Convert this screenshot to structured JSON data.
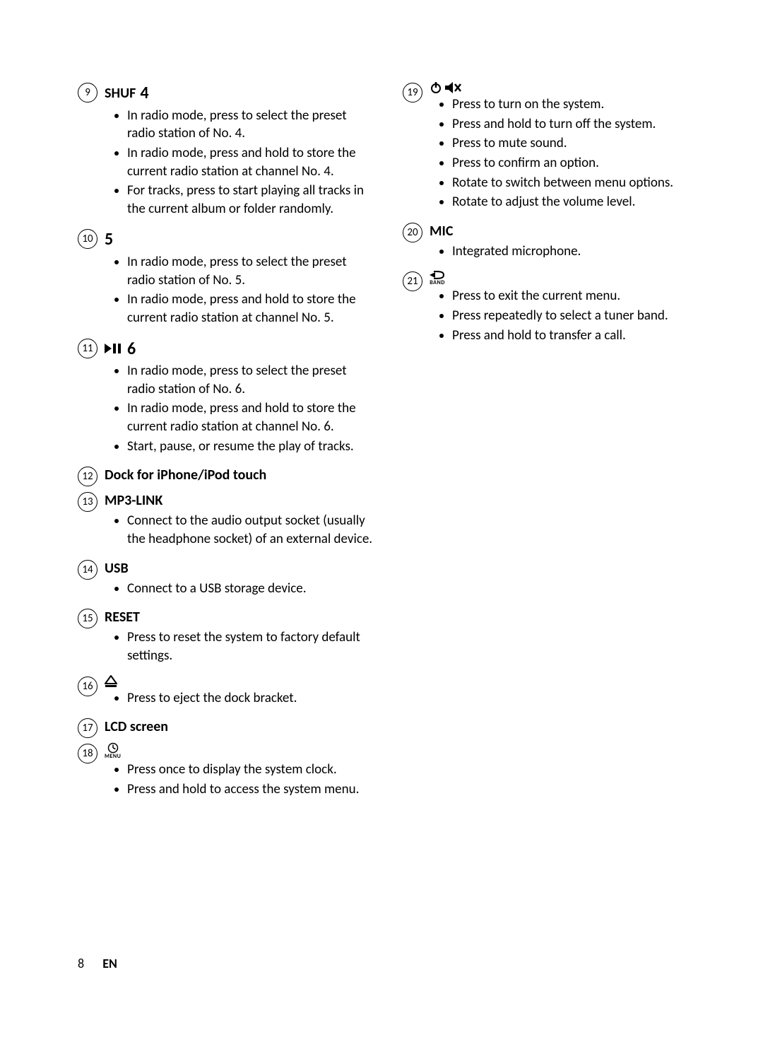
{
  "footer": {
    "page": "8",
    "lang": "EN"
  },
  "left": [
    {
      "num": "9",
      "title_parts": [
        {
          "t": "SHUF "
        },
        {
          "t": "4",
          "cls": "big-num"
        }
      ],
      "bullets": [
        "In radio mode, press to select the preset radio station of No. 4.",
        "In radio mode, press and hold to store the current radio station at channel No. 4.",
        "For tracks, press to start playing all tracks in the current album or folder randomly."
      ]
    },
    {
      "num": "10",
      "title_parts": [
        {
          "t": "5",
          "cls": "big-num"
        }
      ],
      "bullets": [
        "In radio mode, press to select the preset radio station of No. 5.",
        "In radio mode, press and hold to store the current radio station at channel No. 5."
      ]
    },
    {
      "num": "11",
      "title_icon": "play-pause-icon",
      "title_parts": [
        {
          "t": "6",
          "cls": "big-num"
        }
      ],
      "bullets": [
        "In radio mode, press to select the preset radio station of No. 6.",
        "In radio mode, press and hold to store the current radio station at channel No. 6.",
        "Start, pause, or resume the play of tracks."
      ]
    },
    {
      "num": "12",
      "title_parts": [
        {
          "t": "Dock for iPhone/iPod touch"
        }
      ],
      "bullets": []
    },
    {
      "num": "13",
      "title_parts": [
        {
          "t": "MP3-LINK"
        }
      ],
      "bullets": [
        "Connect to the audio output socket (usually the headphone socket) of an external device."
      ]
    },
    {
      "num": "14",
      "title_parts": [
        {
          "t": "USB"
        }
      ],
      "bullets": [
        "Connect to a USB storage device."
      ]
    },
    {
      "num": "15",
      "title_parts": [
        {
          "t": "RESET"
        }
      ],
      "bullets": [
        "Press to reset the system to factory default settings."
      ]
    },
    {
      "num": "16",
      "title_icon": "eject-icon",
      "title_parts": [],
      "bullets": [
        "Press to eject the dock bracket."
      ]
    },
    {
      "num": "17",
      "title_parts": [
        {
          "t": "LCD screen"
        }
      ],
      "bullets": []
    },
    {
      "num": "18",
      "title_icon": "clock-menu-icon",
      "title_parts": [],
      "bullets": [
        "Press once to display the system clock.",
        "Press and hold to access the system menu."
      ]
    }
  ],
  "right": [
    {
      "num": "19",
      "title_icon": "power-mute-icon",
      "title_parts": [],
      "bullets": [
        "Press to turn on the system.",
        "Press and hold to turn off the system.",
        "Press to mute sound.",
        "Press to confirm an option.",
        "Rotate to switch between menu options.",
        "Rotate to adjust the volume level."
      ]
    },
    {
      "num": "20",
      "title_parts": [
        {
          "t": "MIC"
        }
      ],
      "bullets": [
        "Integrated microphone."
      ]
    },
    {
      "num": "21",
      "title_icon": "back-band-icon",
      "title_parts": [],
      "bullets": [
        "Press to exit the current menu.",
        "Press repeatedly to select a tuner band.",
        "Press and hold to transfer a call."
      ]
    }
  ],
  "icon_sublabels": {
    "menu": "MENU",
    "band": "BAND"
  }
}
